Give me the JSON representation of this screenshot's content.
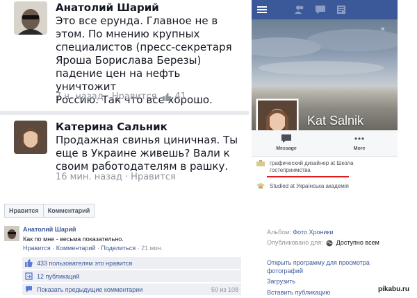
{
  "comments": [
    {
      "author": "Анатолий Шарий",
      "lines": [
        "Это все ерунда. Главное не в",
        "этом. По мнению крупных",
        "специалистов (пресс-секретаря",
        "Яроша Борислава Березы)",
        "падение цен на нефть уничтожит",
        "Россию. Так что все хорошо."
      ],
      "time": "7 ч. назад",
      "separator": "·",
      "like_label": "Нравится",
      "like_count": "41"
    },
    {
      "author": "Катерина Сальник",
      "lines": [
        "Продажная свинья циничная. Ты",
        "еще в Украине живешь? Вали к",
        "своим работодателям в рашку."
      ],
      "time": "16 мин. назад",
      "separator": "·",
      "like_label": "Нравится"
    }
  ],
  "profile": {
    "name": "Kat Salnik",
    "actions": [
      {
        "label": "Message",
        "icon": "chat-bubble-icon"
      },
      {
        "label": "More",
        "icon": "more-dots-icon"
      }
    ],
    "info": [
      {
        "text": "графический дизайнер at Школа",
        "text2": "гостеприимства",
        "icon": "briefcase-icon"
      },
      {
        "text": "Studied at Українська академія",
        "icon": "graduation-cap-icon"
      }
    ],
    "colors": {
      "bar": "#3b5998",
      "underline": "#e01a1a"
    }
  },
  "toolbar": {
    "like_button": "Нравится",
    "comment_button": "Комментарий"
  },
  "post": {
    "author": "Анатолий Шарий",
    "text": "Как по мне - весьма показательно.",
    "meta": {
      "like": "Нравится",
      "comment": "Комментарий",
      "share": "Поделиться",
      "time": "21 мин.",
      "sep": " · "
    },
    "likes_text": "433 пользователям это нравится",
    "shares_text": "12 публикаций",
    "prev_comments_text": "Показать предыдущие комментарии",
    "prev_comments_count": "50 из 108"
  },
  "album": {
    "label": "Альбом:",
    "value": "Фото Хроники",
    "published_label": "Опубликовано для:",
    "published_value": "Доступно всем",
    "open_viewer": "Открыть программу для просмотра",
    "open_viewer_2": "фотографий",
    "download": "Загрузить",
    "embed": "Вставить публикацию"
  },
  "watermark": "pikabu.ru"
}
